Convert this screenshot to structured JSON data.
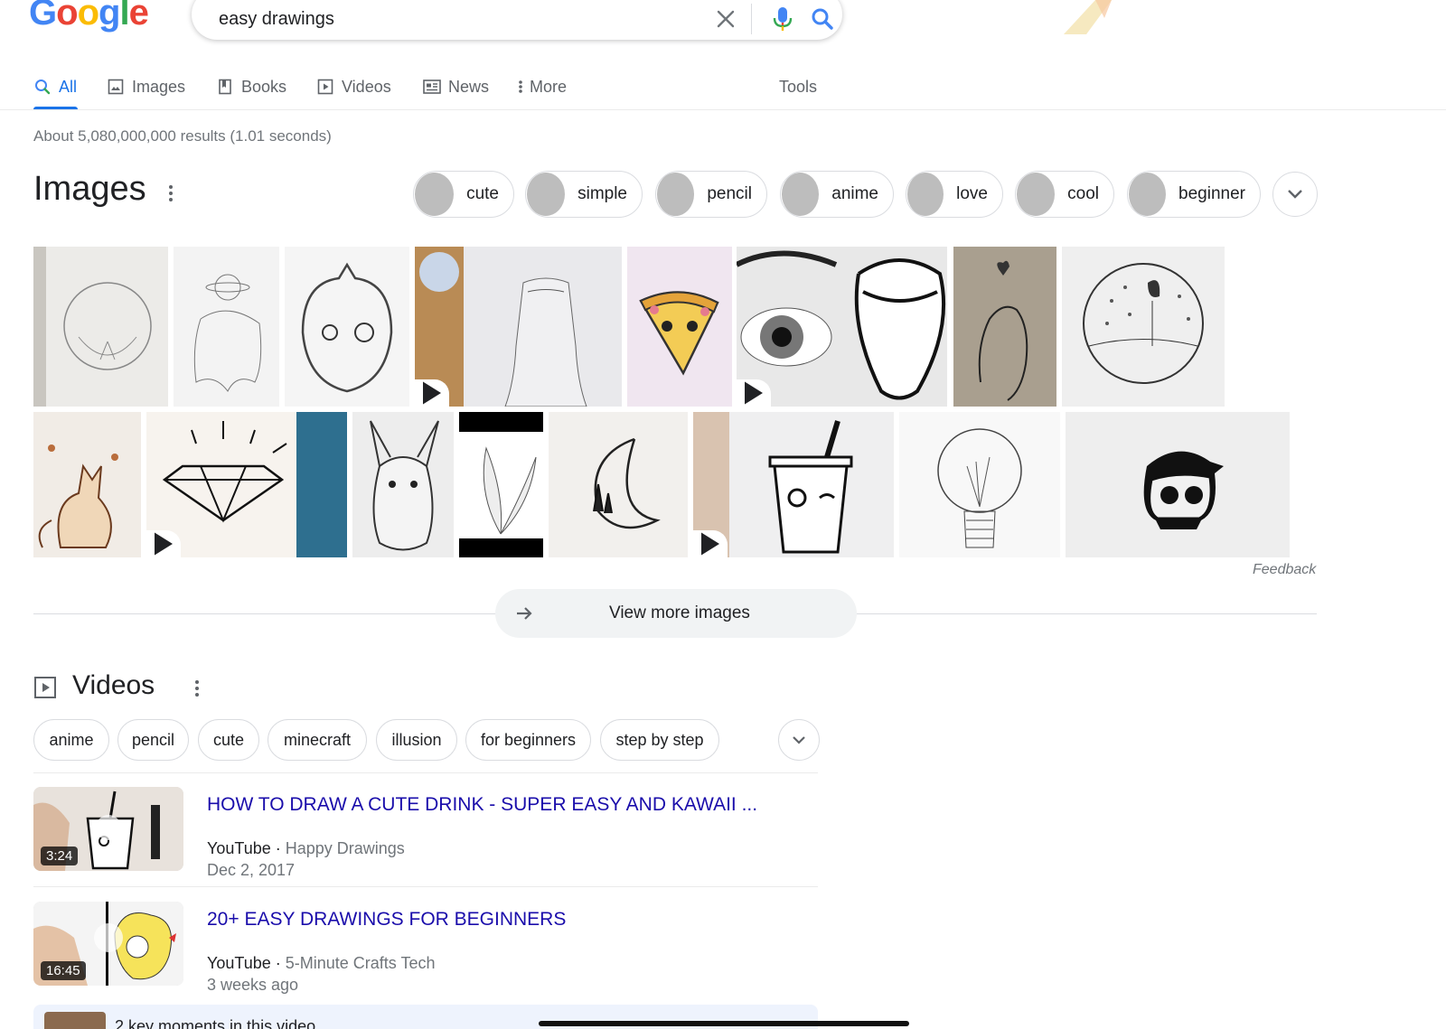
{
  "header": {
    "logo_letters": [
      {
        "ch": "G",
        "color": "#4285F4"
      },
      {
        "ch": "o",
        "color": "#EA4335"
      },
      {
        "ch": "o",
        "color": "#FBBC05"
      },
      {
        "ch": "g",
        "color": "#4285F4"
      },
      {
        "ch": "l",
        "color": "#34A853"
      },
      {
        "ch": "e",
        "color": "#EA4335"
      }
    ],
    "query": "easy drawings",
    "icons": [
      "close-icon",
      "mic-icon",
      "search-icon"
    ]
  },
  "tabs": {
    "all": "All",
    "images": "Images",
    "books": "Books",
    "videos": "Videos",
    "news": "News",
    "more": "More",
    "tools": "Tools"
  },
  "stats": "About 5,080,000,000 results (1.01 seconds)",
  "images_section": {
    "title": "Images",
    "chips": [
      "cute",
      "simple",
      "pencil",
      "anime",
      "love",
      "cool",
      "beginner"
    ],
    "feedback": "Feedback",
    "view_more": "View more images"
  },
  "videos_section": {
    "title": "Videos",
    "chips": [
      "anime",
      "pencil",
      "cute",
      "minecraft",
      "illusion",
      "for beginners",
      "step by step"
    ],
    "items": [
      {
        "title": "HOW TO DRAW A CUTE DRINK - SUPER EASY AND KAWAII ...",
        "source": "YouTube",
        "channel": "Happy Drawings",
        "date": "Dec 2, 2017",
        "duration": "3:24"
      },
      {
        "title": "20+ EASY DRAWINGS FOR BEGINNERS",
        "source": "YouTube",
        "channel": "5-Minute Crafts Tech",
        "date": "3 weeks ago",
        "duration": "16:45"
      }
    ],
    "key_moments": "2 key moments in this video"
  },
  "colors": {
    "accent": "#1a73e8",
    "link": "#1a0dab",
    "muted": "#70757a"
  }
}
